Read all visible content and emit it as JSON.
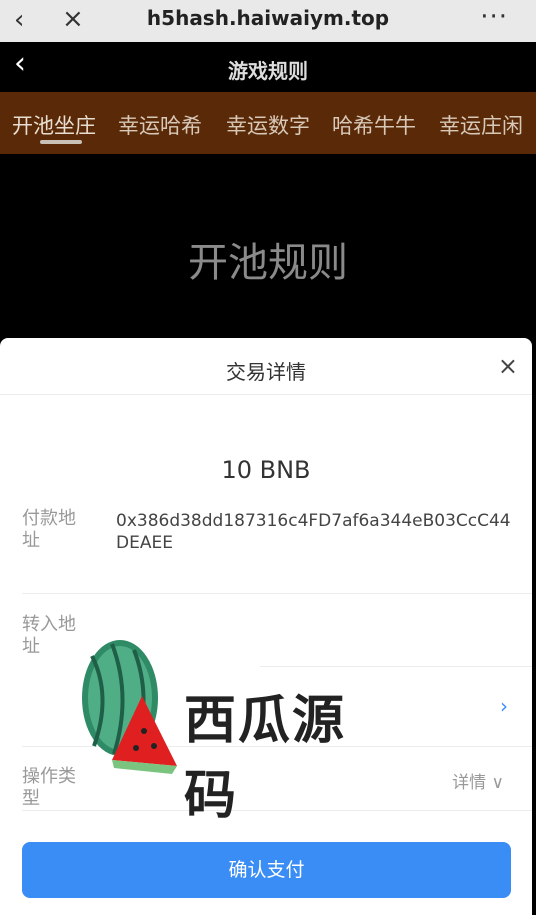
{
  "browser": {
    "url": "h5hash.haiwaiym.top",
    "back_icon": "‹",
    "close_icon": "×",
    "more_icon": "···"
  },
  "app": {
    "title": "游戏规则",
    "back_icon": "‹"
  },
  "tabs": [
    {
      "label": "开池坐庄",
      "active": true
    },
    {
      "label": "幸运哈希",
      "active": false
    },
    {
      "label": "幸运数字",
      "active": false
    },
    {
      "label": "哈希牛牛",
      "active": false
    },
    {
      "label": "幸运庄闲",
      "active": false
    }
  ],
  "hero": {
    "title": "开池规则"
  },
  "sheet": {
    "title": "交易详情",
    "close_icon": "×",
    "amount": "10 BNB",
    "payer_label": "付款地址",
    "payer_value": "0x386d38dd187316c4FD7af6a344eB03CcC44DEAEE",
    "receiver_label": "转入地址",
    "receiver_value": "",
    "chevron": "›",
    "operation_label": "操作类型",
    "operation_detail": "详情 ∨",
    "confirm_label": "确认支付"
  },
  "watermark": {
    "text": "西瓜源码"
  },
  "colors": {
    "tab_bg": "#5a2a08",
    "confirm_bg": "#3a8df5",
    "accent": "#3b8dff"
  }
}
